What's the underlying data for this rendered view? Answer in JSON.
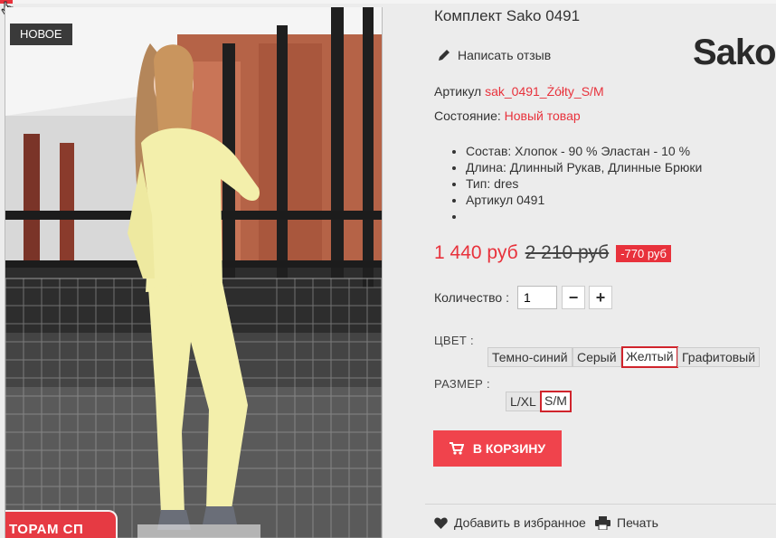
{
  "badge": {
    "new": "НОВОЕ"
  },
  "promo": {
    "label": "ТОРАМ СП"
  },
  "product": {
    "title": "Комплект Sako 0491",
    "brand": "Sako",
    "review_label": "Написать отзыв",
    "sku_label": "Артикул",
    "sku_value": "sak_0491_Żółty_S/M",
    "condition_label": "Состояние:",
    "condition_value": "Новый товар",
    "features": [
      "Состав: Хлопок - 90 % Эластан - 10 %",
      "Длина: Длинный Рукав, Длинные Брюки",
      "Тип: dres",
      "Артикул 0491",
      ""
    ]
  },
  "price": {
    "current": "1 440 руб",
    "old": "2 210 руб",
    "discount": "-770 руб"
  },
  "quantity": {
    "label": "Количество :",
    "value": "1",
    "minus": "−",
    "plus": "+"
  },
  "color": {
    "label": "ЦВЕТ :",
    "options": [
      "Темно-синий",
      "Серый",
      "Желтый",
      "Графитовый"
    ],
    "selected": "Желтый"
  },
  "size": {
    "label": "РАЗМЕР :",
    "options": [
      "L/XL",
      "S/M"
    ],
    "selected": "S/M"
  },
  "cart": {
    "label": "В КОРЗИНУ"
  },
  "footer": {
    "wishlist": "Добавить в избранное",
    "print": "Печать"
  },
  "colors": {
    "accent": "#e8323c",
    "cart_bg": "#f0434c",
    "outfit": "#f3efab"
  },
  "icons": [
    "cursor-hand-icon",
    "pencil-icon",
    "cart-icon",
    "heart-icon",
    "printer-icon"
  ]
}
